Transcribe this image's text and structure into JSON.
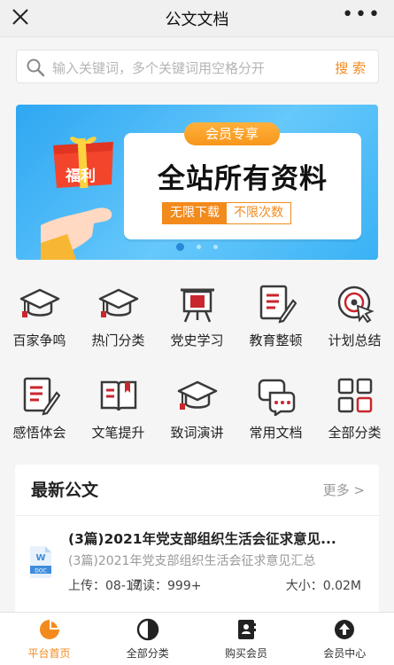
{
  "header": {
    "title": "公文文档",
    "close_icon": "close-icon",
    "more_icon": "more-dots-icon"
  },
  "search": {
    "placeholder": "输入关键词，多个关键词用空格分开",
    "button_label": "搜 索",
    "icon": "search-icon"
  },
  "banner": {
    "pill": "会员专享",
    "headline": "全站所有资料",
    "tag_left": "无限下载",
    "tag_right": "不限次数",
    "gift_text": "福利",
    "active_slide": 1,
    "slide_count": 3
  },
  "categories": [
    {
      "label": "百家争鸣",
      "icon": "graduation-cap-icon"
    },
    {
      "label": "热门分类",
      "icon": "graduation-cap-icon"
    },
    {
      "label": "党史学习",
      "icon": "party-flag-board-icon"
    },
    {
      "label": "教育整顿",
      "icon": "document-edit-icon"
    },
    {
      "label": "计划总结",
      "icon": "target-cursor-icon"
    },
    {
      "label": "感悟体会",
      "icon": "document-edit-icon"
    },
    {
      "label": "文笔提升",
      "icon": "open-book-icon"
    },
    {
      "label": "致词演讲",
      "icon": "graduation-cap-icon"
    },
    {
      "label": "常用文档",
      "icon": "chat-bubbles-icon"
    },
    {
      "label": "全部分类",
      "icon": "grid-icon"
    }
  ],
  "latest": {
    "title": "最新公文",
    "more": "更多 >",
    "items": [
      {
        "title": "(3篇)2021年党支部组织生活会征求意见...",
        "subtitle": "(3篇)2021年党支部组织生活会征求意见汇总",
        "upload": "上传：08-17",
        "reads": "阅读：999+",
        "size": "大小：0.02M",
        "file_icon": "word-doc-icon"
      }
    ]
  },
  "tabbar": [
    {
      "label": "平台首页",
      "icon": "pie-chart-icon",
      "active": true
    },
    {
      "label": "全部分类",
      "icon": "half-circle-icon",
      "active": false
    },
    {
      "label": "购买会员",
      "icon": "contact-book-icon",
      "active": false
    },
    {
      "label": "会员中心",
      "icon": "upload-circle-icon",
      "active": false
    }
  ],
  "colors": {
    "accent": "#f38a1c",
    "icon_red": "#c9262d",
    "icon_dark": "#3a3a3a",
    "banner_blue": "#3ab2f5"
  }
}
